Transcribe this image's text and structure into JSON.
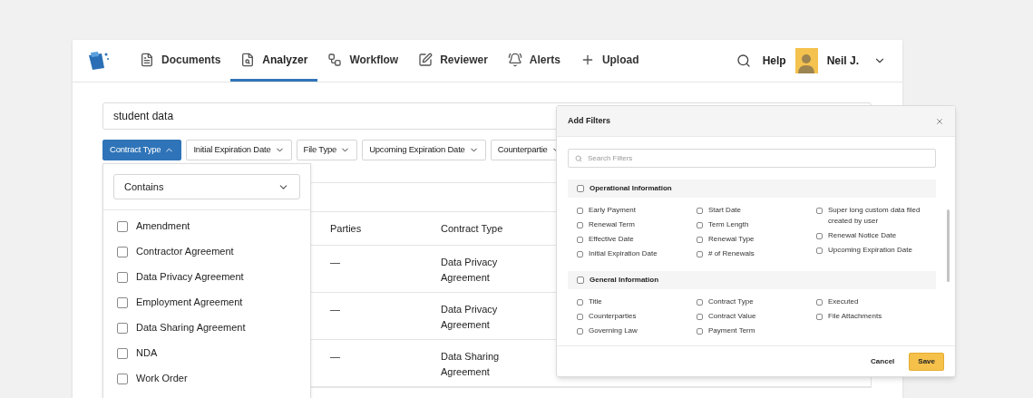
{
  "nav": {
    "tabs": [
      {
        "label": "Documents",
        "selected": false
      },
      {
        "label": "Analyzer",
        "selected": true
      },
      {
        "label": "Workflow",
        "selected": false
      },
      {
        "label": "Reviewer",
        "selected": false
      },
      {
        "label": "Alerts",
        "selected": false
      },
      {
        "label": "Upload",
        "selected": false
      }
    ],
    "help": "Help",
    "user": "Neil J."
  },
  "search": {
    "value": "student data"
  },
  "filter_chips": [
    {
      "label": "Contract Type",
      "expanded": true
    },
    {
      "label": "Initial Expiration Date",
      "expanded": false
    },
    {
      "label": "File Type",
      "expanded": false
    },
    {
      "label": "Upcoming Expiration Date",
      "expanded": false
    },
    {
      "label": "Counterpartie",
      "expanded": false
    }
  ],
  "dropdown": {
    "operator": "Contains",
    "options": [
      {
        "label": "Amendment",
        "checked": false
      },
      {
        "label": "Contractor Agreement",
        "checked": false
      },
      {
        "label": "Data Privacy Agreement",
        "checked": false
      },
      {
        "label": "Employment Agreement",
        "checked": false
      },
      {
        "label": "Data Sharing Agreement",
        "checked": false
      },
      {
        "label": "NDA",
        "checked": false
      },
      {
        "label": "Work Order",
        "checked": false
      }
    ]
  },
  "table": {
    "columns": [
      "Parties",
      "Contract Type"
    ],
    "rows": [
      [
        "—",
        "Data Privacy Agreement"
      ],
      [
        "—",
        "Data Privacy Agreement"
      ],
      [
        "—",
        "Data Sharing Agreement"
      ]
    ]
  },
  "add_filters": {
    "title": "Add Filters",
    "search_placeholder": "Search Filters",
    "sections": [
      {
        "title": "Operational Information",
        "checked": false,
        "columns": [
          [
            {
              "label": "Early Payment",
              "checked": false
            },
            {
              "label": "Renewal Term",
              "checked": false
            },
            {
              "label": "Effective Date",
              "checked": false
            },
            {
              "label": "Initial Expiration Date",
              "checked": false
            }
          ],
          [
            {
              "label": "Start Date",
              "checked": false
            },
            {
              "label": "Term Length",
              "checked": false
            },
            {
              "label": "Renewal Type",
              "checked": false
            },
            {
              "label": "# of Renewals",
              "checked": false
            }
          ],
          [
            {
              "label": "Super long custom data filed created by user",
              "checked": false
            },
            {
              "label": "Renewal Notice Date",
              "checked": false
            },
            {
              "label": "Upcoming Expiration Date",
              "checked": false
            }
          ]
        ]
      },
      {
        "title": "General Information",
        "checked": false,
        "columns": [
          [
            {
              "label": "Title",
              "checked": false
            },
            {
              "label": "Counterparties",
              "checked": false
            },
            {
              "label": "Governing Law",
              "checked": false
            }
          ],
          [
            {
              "label": "Contract Type",
              "checked": false
            },
            {
              "label": "Contract Value",
              "checked": false
            },
            {
              "label": "Payment Term",
              "checked": false
            }
          ],
          [
            {
              "label": "Executed",
              "checked": false
            },
            {
              "label": "File Attachments",
              "checked": false
            }
          ]
        ]
      }
    ],
    "buttons": {
      "cancel": "Cancel",
      "save": "Save"
    }
  }
}
